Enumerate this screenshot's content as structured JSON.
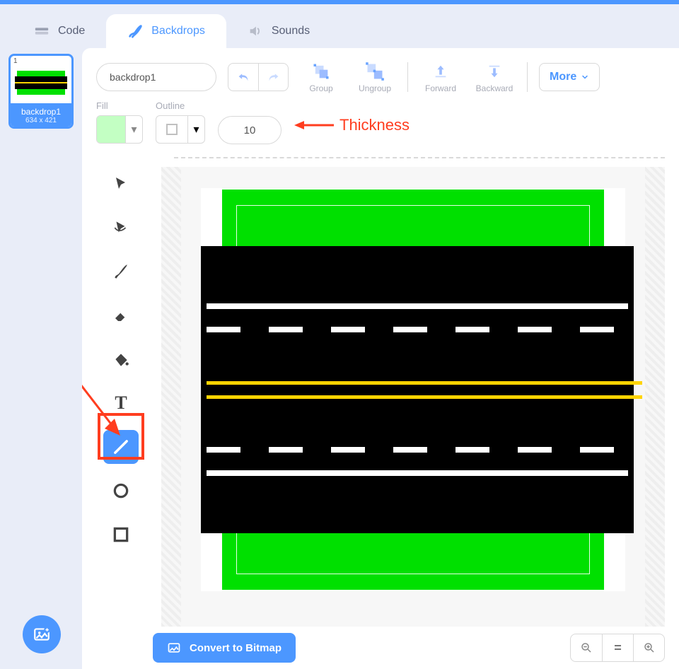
{
  "tabs": {
    "code": "Code",
    "backdrops": "Backdrops",
    "sounds": "Sounds",
    "active": "backdrops"
  },
  "thumb": {
    "index": "1",
    "name": "backdrop1",
    "dims": "634 x 421"
  },
  "header": {
    "costume_name": "backdrop1",
    "group": "Group",
    "ungroup": "Ungroup",
    "forward": "Forward",
    "backward": "Backward",
    "more": "More"
  },
  "props": {
    "fill_label": "Fill",
    "outline_label": "Outline",
    "outline_width": "10"
  },
  "annotation": {
    "thickness": "Thickness"
  },
  "tools": {
    "select": "select",
    "reshape": "reshape",
    "brush": "brush",
    "eraser": "eraser",
    "fill": "fill",
    "text": "text",
    "line": "line",
    "circle": "circle",
    "rect": "rect",
    "active": "line"
  },
  "bottom": {
    "convert": "Convert to Bitmap"
  },
  "zoom": {
    "out": "−",
    "reset": "=",
    "in": "+"
  }
}
